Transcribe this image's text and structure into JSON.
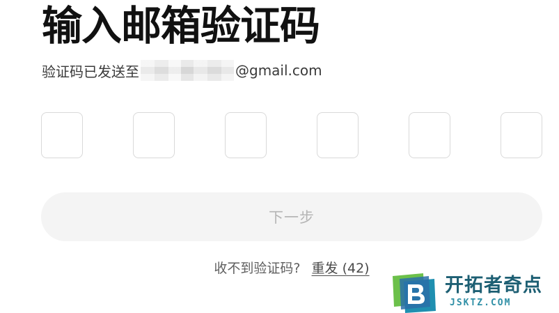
{
  "header": {
    "title": "输入邮箱验证码",
    "subtitle_prefix": "验证码已发送至",
    "email_domain": "@gmail.com"
  },
  "code_inputs": [
    {
      "value": ""
    },
    {
      "value": ""
    },
    {
      "value": ""
    },
    {
      "value": ""
    },
    {
      "value": ""
    },
    {
      "value": ""
    }
  ],
  "next_button": {
    "label": "下一步",
    "state": "disabled"
  },
  "resend": {
    "prompt": "收不到验证码?",
    "link_label": "重发 (42)"
  },
  "watermark": {
    "name": "开拓者奇点",
    "domain": "JSKTZ.COM"
  },
  "colors": {
    "title": "#111111",
    "button_bg": "#f4f4f4",
    "button_text": "#b5b5b5",
    "box_border": "#d9d9d9",
    "watermark_green": "#6cc04a",
    "watermark_blue": "#1d5f73"
  }
}
